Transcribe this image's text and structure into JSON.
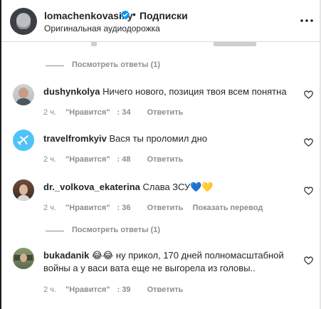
{
  "header": {
    "username": "lomachenkovasiliy",
    "dot": "•",
    "follow_label": "Подписки",
    "audio_label": "Оригинальная аудиодорожка"
  },
  "view_replies_label": "Посмотреть ответы (1)",
  "like_label": "\"Нравится\"",
  "reply_label": "Ответить",
  "translate_label": "Показать перевод",
  "comments": [
    {
      "username": "dushynkolya",
      "text": "Ничего нового, позиция твоя всем понятна",
      "time": "2 ч.",
      "likes": "34"
    },
    {
      "username": "travelfromkyiv",
      "text": "Вася ты проломил дно",
      "time": "2 ч.",
      "likes": "48"
    },
    {
      "username": "dr._volkova_ekaterina",
      "text": "Слава ЗСУ💙💛",
      "time": "2 ч.",
      "likes": "36"
    },
    {
      "username": "bukadanik",
      "text": "😂😂 ну прикол, 170 дней полномасштабной войны а у васи вата еще не выгорела из головы..",
      "time": "2 ч.",
      "likes": "39"
    }
  ],
  "colors": {
    "text": "#262626",
    "secondary": "#8e8e8e",
    "verified": "#0095f6",
    "divider": "#dbdbdb"
  }
}
